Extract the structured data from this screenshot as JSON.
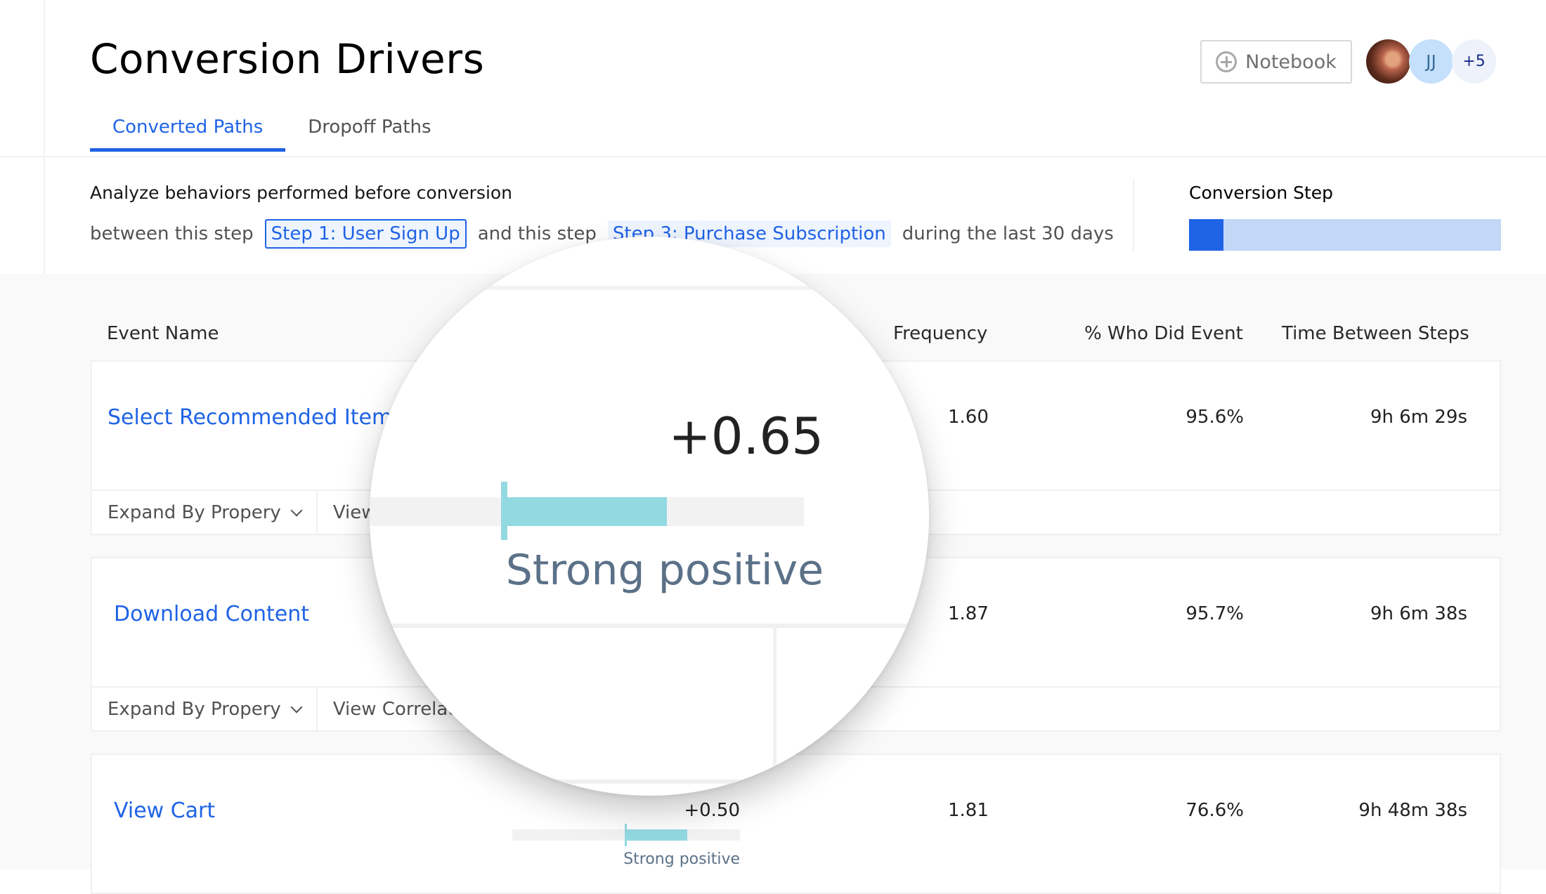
{
  "header": {
    "title": "Conversion Drivers",
    "notebook_label": "Notebook",
    "avatars": [
      {
        "type": "photo",
        "label": ""
      },
      {
        "type": "initials",
        "label": "JJ"
      },
      {
        "type": "overflow",
        "label": "+5"
      }
    ]
  },
  "tabs": [
    {
      "label": "Converted Paths",
      "active": true
    },
    {
      "label": "Dropoff Paths",
      "active": false
    }
  ],
  "analyze": {
    "title": "Analyze behaviors performed before conversion",
    "between_text": "between this step",
    "from_step": "Step 1: User Sign Up",
    "and_text": "and this step",
    "to_step": "Step 3: Purchase Subscription",
    "period_text": "during the last 30 days"
  },
  "conversion_step": {
    "label": "Conversion Step",
    "progress_fraction": 0.11,
    "colors": {
      "fill": "#1f63e6",
      "track": "#c3d7f6"
    }
  },
  "table": {
    "columns": [
      "Event Name",
      "Frequency",
      "% Who Did Event",
      "Time Between Steps"
    ],
    "rows": [
      {
        "event": "Select Recommended Item",
        "correlation": "+0.65",
        "correlation_value": 0.65,
        "correlation_label": "Strong positive",
        "frequency": "1.60",
        "pct_who_did": "95.6%",
        "time_between": "9h 6m 29s",
        "actions": [
          "Expand By Propery",
          "View Correlation"
        ]
      },
      {
        "event": "Download Content",
        "correlation": "",
        "correlation_value": null,
        "correlation_label": "",
        "frequency": "1.87",
        "pct_who_did": "95.7%",
        "time_between": "9h 6m 38s",
        "actions": [
          "Expand By Propery",
          "View Correlation"
        ]
      },
      {
        "event": "View Cart",
        "correlation": "+0.50",
        "correlation_value": 0.5,
        "correlation_label": "Strong positive",
        "frequency": "1.81",
        "pct_who_did": "76.6%",
        "time_between": "9h 48m 38s",
        "actions": []
      }
    ]
  },
  "magnifier": {
    "value": "+0.65",
    "value_number": 0.65,
    "label": "Strong positive"
  },
  "colors": {
    "accent": "#1f63e6",
    "correlation_bar": "#93d9e2",
    "correlation_label": "#5b7188"
  }
}
